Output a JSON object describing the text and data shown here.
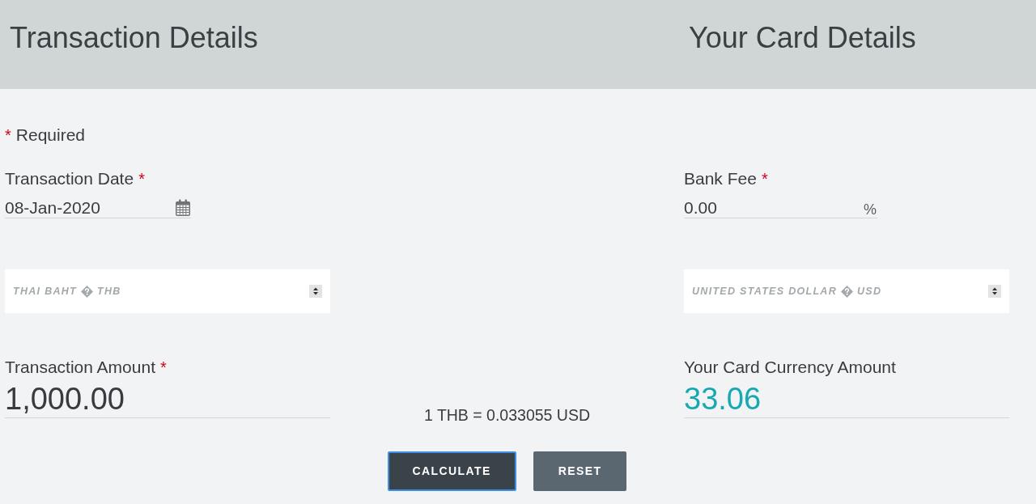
{
  "transaction": {
    "title": "Transaction Details",
    "date": {
      "label": "Transaction Date",
      "required_mark": "*",
      "value": "08-Jan-2020"
    },
    "currency": {
      "name": "THAI BAHT",
      "code": "THB"
    },
    "amount": {
      "label": "Transaction Amount",
      "required_mark": "*",
      "value": "1,000.00"
    }
  },
  "card": {
    "title": "Your Card Details",
    "bank_fee": {
      "label": "Bank Fee",
      "required_mark": "*",
      "value": "0.00",
      "unit": "%"
    },
    "currency": {
      "name": "UNITED STATES DOLLAR",
      "code": "USD"
    },
    "amount": {
      "label": "Your Card Currency Amount",
      "value": "33.06"
    }
  },
  "required_note": {
    "mark": "*",
    "text": "Required"
  },
  "exchange_rate": "1 THB = 0.033055 USD",
  "buttons": [
    {
      "label": "CALCULATE",
      "kind": "primary",
      "focused": true
    },
    {
      "label": "RESET",
      "kind": "secondary",
      "focused": false
    }
  ]
}
